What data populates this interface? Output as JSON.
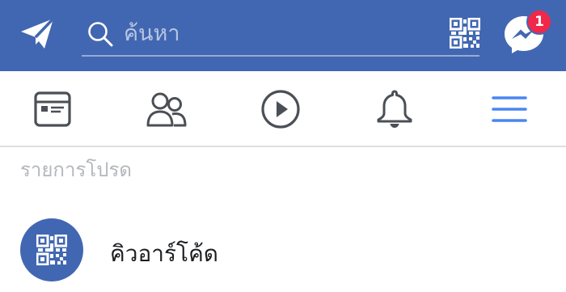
{
  "colors": {
    "brand": "#4267b2",
    "badge": "#f02849",
    "active_tab": "#4a86f2",
    "inactive_icon": "#4b4f56",
    "section_text": "#b4b7bd"
  },
  "header": {
    "send_icon": "paper-plane-icon",
    "search": {
      "icon": "search-icon",
      "placeholder": "ค้นหา",
      "value": ""
    },
    "qr_icon": "qr-code-icon",
    "messenger": {
      "icon": "messenger-icon",
      "badge_count": "1"
    }
  },
  "tabs": [
    {
      "icon": "news-feed-icon",
      "active": false
    },
    {
      "icon": "friends-icon",
      "active": false
    },
    {
      "icon": "watch-play-icon",
      "active": false
    },
    {
      "icon": "notifications-bell-icon",
      "active": false
    },
    {
      "icon": "menu-hamburger-icon",
      "active": true
    }
  ],
  "favorites": {
    "header": "รายการโปรด",
    "items": [
      {
        "icon": "qr-code-icon",
        "label": "คิวอาร์โค้ด"
      }
    ]
  }
}
